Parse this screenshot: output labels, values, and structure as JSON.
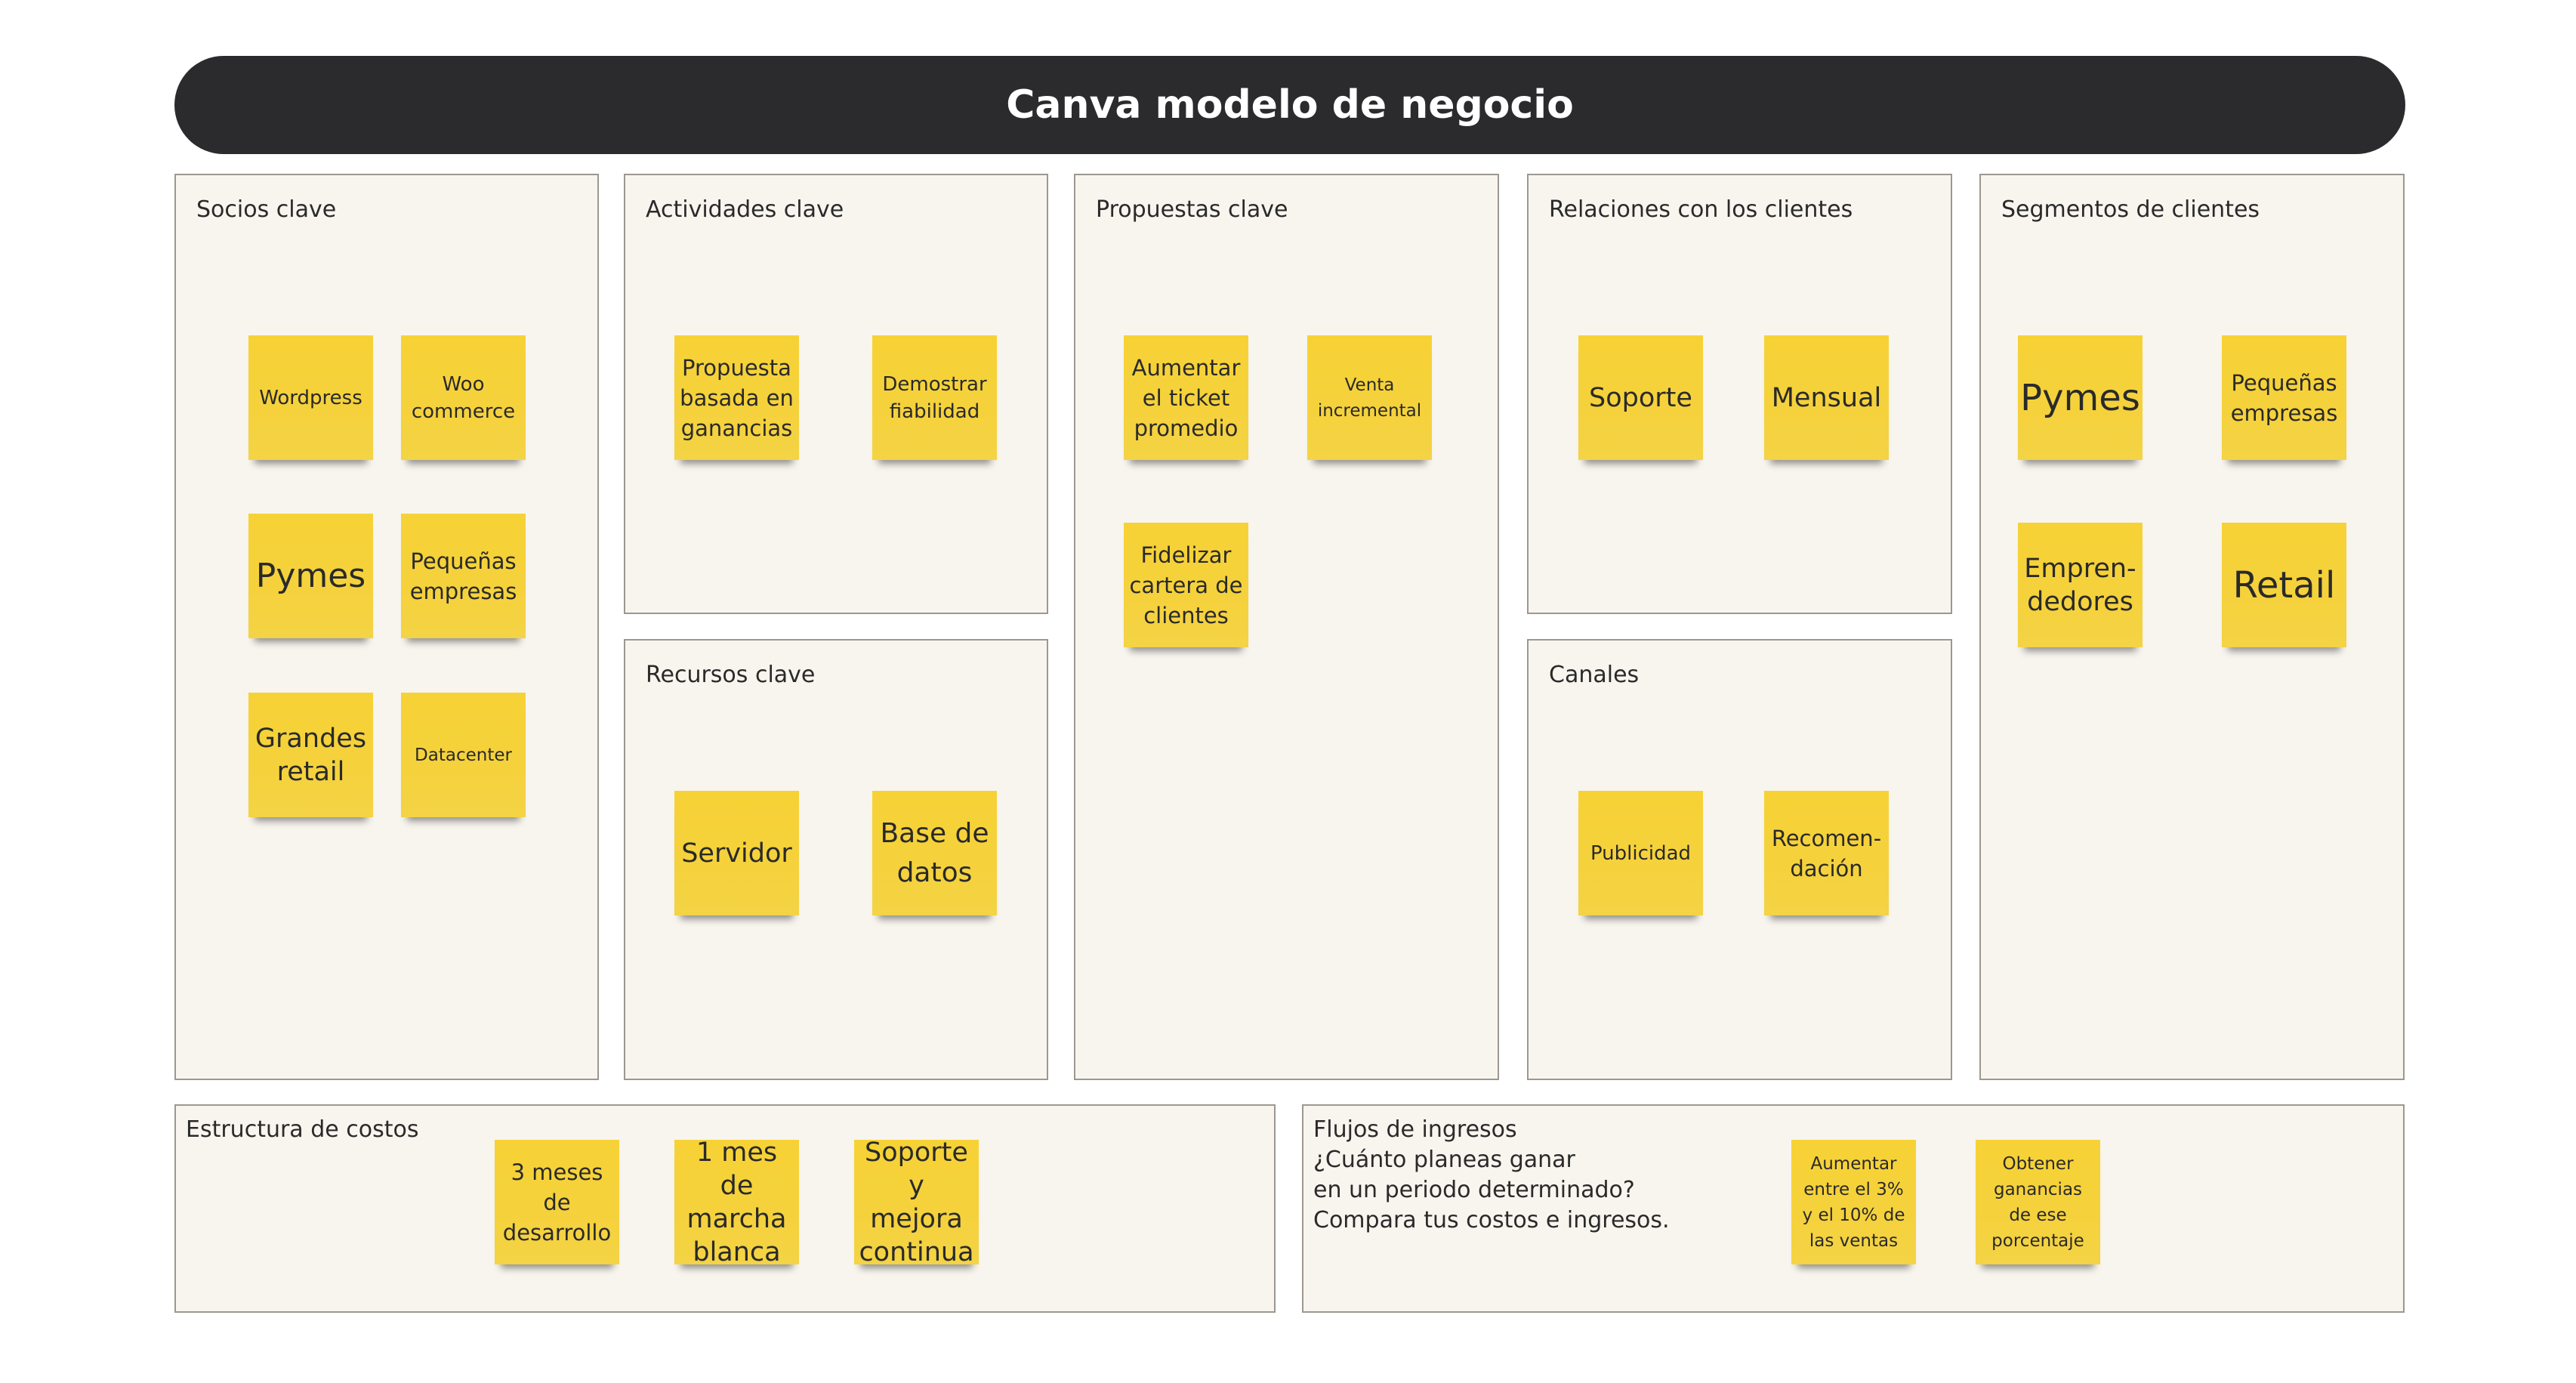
{
  "header": {
    "title": "Canva modelo de negocio"
  },
  "panels": {
    "socios": {
      "title": "Socios clave",
      "notes": [
        "Wordpress",
        "Woo\ncommerce",
        "Pymes",
        "Pequeñas\nempresas",
        "Grandes\nretail",
        "Datacenter"
      ]
    },
    "actividades": {
      "title": "Actividades clave",
      "notes": [
        "Propuesta\nbasada en\nganancias",
        "Demostrar\nfiabilidad"
      ]
    },
    "recursos": {
      "title": "Recursos clave",
      "notes": [
        "Servidor",
        "Base de\ndatos"
      ]
    },
    "propuestas": {
      "title": "Propuestas clave",
      "notes": [
        "Aumentar\nel ticket\npromedio",
        "Venta\nincremental",
        "Fidelizar\ncartera de\nclientes"
      ]
    },
    "relaciones": {
      "title": "Relaciones con los clientes",
      "notes": [
        "Soporte",
        "Mensual"
      ]
    },
    "canales": {
      "title": "Canales",
      "notes": [
        "Publicidad",
        "Recomen-\ndación"
      ]
    },
    "segmentos": {
      "title": "Segmentos de clientes",
      "notes": [
        "Pymes",
        "Pequeñas\nempresas",
        "Empren-\ndedores",
        "Retail"
      ]
    },
    "costos": {
      "title": "Estructura de costos",
      "notes": [
        "3 meses\nde\ndesarrollo",
        "1 mes de\nmarcha\nblanca",
        "Soporte\ny mejora\ncontinua"
      ]
    },
    "ingresos": {
      "title": "Flujos de ingresos",
      "description": "¿Cuánto planeas ganar\nen un periodo determinado?\nCompara tus costos e ingresos.",
      "notes": [
        "Aumentar\nentre el 3%\ny el 10% de\nlas ventas",
        "Obtener\nganancias\nde ese\nporcentaje"
      ]
    }
  },
  "colors": {
    "header_bg": "#2b2b2e",
    "panel_bg": "#f8f5ef",
    "panel_border": "#9c9890",
    "sticky": "#f6d236"
  }
}
